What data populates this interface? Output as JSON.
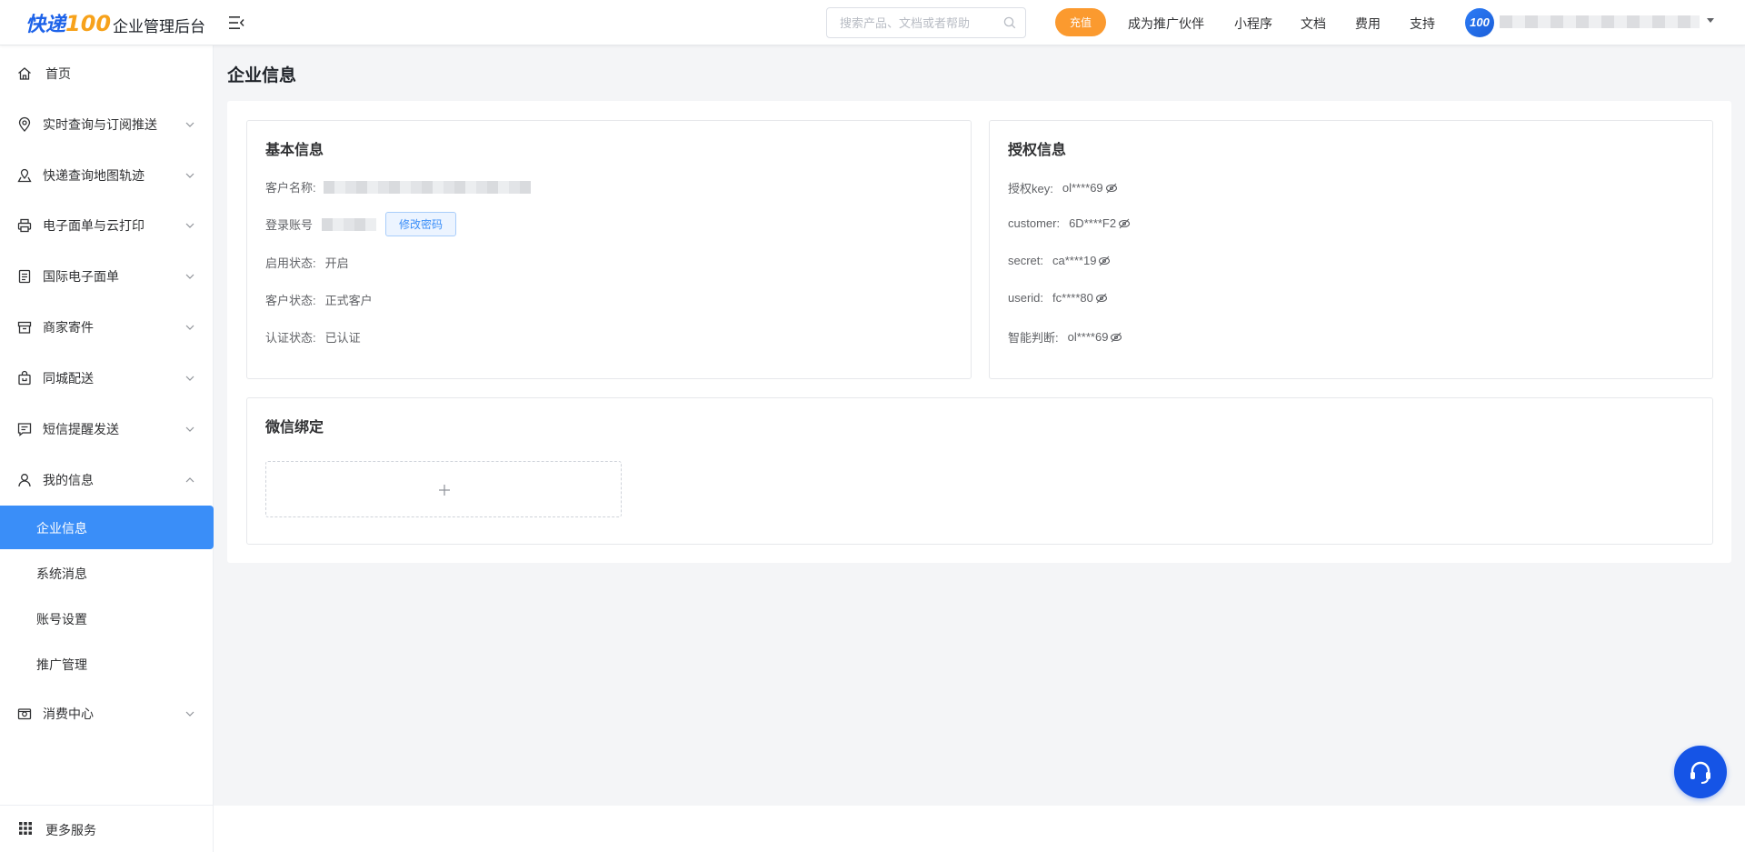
{
  "header": {
    "logo_text": "快递",
    "logo_num": "100",
    "app_title": "企业管理后台",
    "search_placeholder": "搜索产品、文档或者帮助",
    "recharge_label": "充值",
    "nav": [
      "成为推广伙伴",
      "小程序",
      "文档",
      "费用",
      "支持"
    ],
    "avatar_text": "100"
  },
  "sidebar": {
    "items": [
      {
        "label": "首页",
        "icon": "home-icon"
      },
      {
        "label": "实时查询与订阅推送",
        "icon": "location-pin-icon"
      },
      {
        "label": "快递查询地图轨迹",
        "icon": "map-track-icon"
      },
      {
        "label": "电子面单与云打印",
        "icon": "printer-icon"
      },
      {
        "label": "国际电子面单",
        "icon": "document-icon"
      },
      {
        "label": "商家寄件",
        "icon": "box-icon"
      },
      {
        "label": "同城配送",
        "icon": "bag-icon"
      },
      {
        "label": "短信提醒发送",
        "icon": "message-icon"
      },
      {
        "label": "我的信息",
        "icon": "user-icon"
      },
      {
        "label": "消费中心",
        "icon": "wallet-icon"
      }
    ],
    "sub_items": [
      "企业信息",
      "系统消息",
      "账号设置",
      "推广管理"
    ],
    "footer_label": "更多服务"
  },
  "main": {
    "page_title": "企业信息",
    "basic": {
      "title": "基本信息",
      "customer_name_label": "客户名称:",
      "login_account_label": "登录账号",
      "change_password_label": "修改密码",
      "enable_status_label": "启用状态:",
      "enable_status_value": "开启",
      "customer_status_label": "客户状态:",
      "customer_status_value": "正式客户",
      "cert_status_label": "认证状态:",
      "cert_status_value": "已认证"
    },
    "auth": {
      "title": "授权信息",
      "rows": [
        {
          "label": "授权key:",
          "value": "ol****69"
        },
        {
          "label": "customer:",
          "value": "6D****F2"
        },
        {
          "label": "secret:",
          "value": "ca****19"
        },
        {
          "label": "userid:",
          "value": "fc****80"
        },
        {
          "label": "智能判断:",
          "value": "ol****69"
        }
      ]
    },
    "wechat": {
      "title": "微信绑定"
    }
  },
  "colors": {
    "primary": "#3a8ef8",
    "accent_orange": "#fb9a2f",
    "support_blue": "#1554e6"
  }
}
